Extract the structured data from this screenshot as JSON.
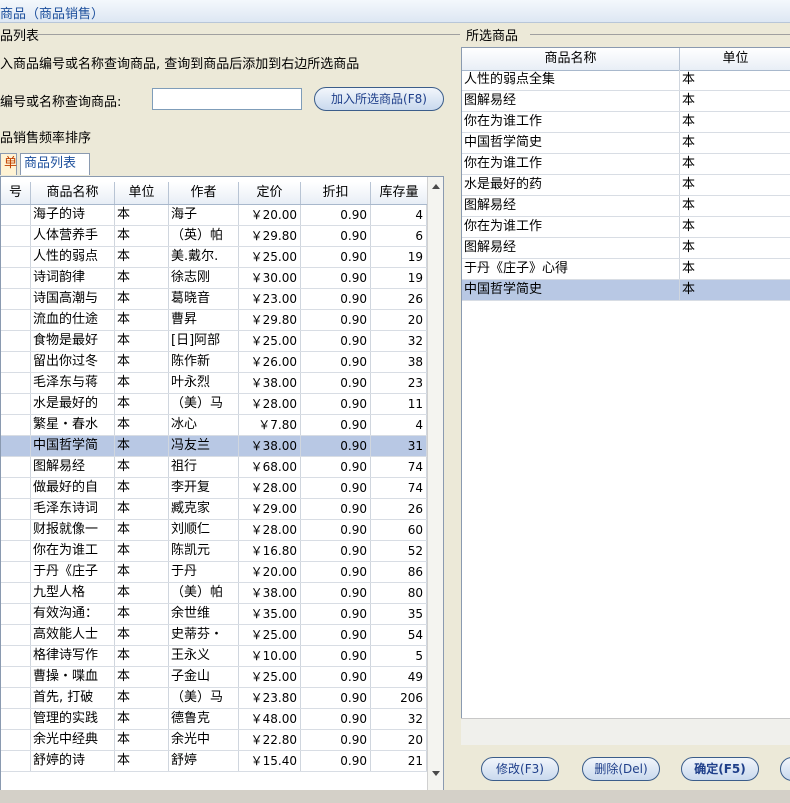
{
  "window": {
    "title": "商品（商品销售）"
  },
  "left_panel": {
    "group_title": "品列表",
    "instruction": "入商品编号或名称查询商品, 查询到商品后添加到右边所选商品",
    "search_label": "编号或名称查询商品:",
    "search_value": "",
    "add_button": "加入所选商品(F8)",
    "sort_title": "品销售频率排序",
    "tabs": [
      "单",
      "商品列表"
    ],
    "columns": [
      "号",
      "商品名称",
      "单位",
      "作者",
      "定价",
      "折扣",
      "库存量"
    ],
    "rows": [
      {
        "id": "",
        "name": "海子的诗",
        "unit": "本",
        "author": "海子",
        "price": "￥20.00",
        "discount": "0.90",
        "stock": "4"
      },
      {
        "id": "",
        "name": "人体营养手",
        "unit": "本",
        "author": "（英）帕",
        "price": "￥29.80",
        "discount": "0.90",
        "stock": "6"
      },
      {
        "id": "",
        "name": "人性的弱点",
        "unit": "本",
        "author": "美.戴尔.",
        "price": "￥25.00",
        "discount": "0.90",
        "stock": "19"
      },
      {
        "id": "",
        "name": "诗词韵律",
        "unit": "本",
        "author": "徐志刚",
        "price": "￥30.00",
        "discount": "0.90",
        "stock": "19"
      },
      {
        "id": "",
        "name": "诗国高潮与",
        "unit": "本",
        "author": "葛晓音",
        "price": "￥23.00",
        "discount": "0.90",
        "stock": "26"
      },
      {
        "id": "",
        "name": "流血的仕途",
        "unit": "本",
        "author": "曹昇",
        "price": "￥29.80",
        "discount": "0.90",
        "stock": "20"
      },
      {
        "id": "",
        "name": "食物是最好",
        "unit": "本",
        "author": "[日]阿部",
        "price": "￥25.00",
        "discount": "0.90",
        "stock": "32"
      },
      {
        "id": "",
        "name": "留出你过冬",
        "unit": "本",
        "author": "陈作新",
        "price": "￥26.00",
        "discount": "0.90",
        "stock": "38"
      },
      {
        "id": "",
        "name": "毛泽东与蒋",
        "unit": "本",
        "author": "叶永烈",
        "price": "￥38.00",
        "discount": "0.90",
        "stock": "23"
      },
      {
        "id": "",
        "name": "水是最好的",
        "unit": "本",
        "author": "（美）马",
        "price": "￥28.00",
        "discount": "0.90",
        "stock": "11"
      },
      {
        "id": "",
        "name": "繁星・春水",
        "unit": "本",
        "author": "冰心",
        "price": "￥7.80",
        "discount": "0.90",
        "stock": "4"
      },
      {
        "id": "",
        "name": "中国哲学简",
        "unit": "本",
        "author": "冯友兰",
        "price": "￥38.00",
        "discount": "0.90",
        "stock": "31",
        "selected": true
      },
      {
        "id": "",
        "name": "图解易经",
        "unit": "本",
        "author": "祖行",
        "price": "￥68.00",
        "discount": "0.90",
        "stock": "74"
      },
      {
        "id": "",
        "name": "做最好的自",
        "unit": "本",
        "author": "李开复",
        "price": "￥28.00",
        "discount": "0.90",
        "stock": "74"
      },
      {
        "id": "",
        "name": "毛泽东诗词",
        "unit": "本",
        "author": "臧克家",
        "price": "￥29.00",
        "discount": "0.90",
        "stock": "26"
      },
      {
        "id": "",
        "name": "财报就像一",
        "unit": "本",
        "author": "刘顺仁",
        "price": "￥28.00",
        "discount": "0.90",
        "stock": "60"
      },
      {
        "id": "",
        "name": "你在为谁工",
        "unit": "本",
        "author": "陈凯元",
        "price": "￥16.80",
        "discount": "0.90",
        "stock": "52"
      },
      {
        "id": "",
        "name": "于丹《庄子",
        "unit": "本",
        "author": "于丹",
        "price": "￥20.00",
        "discount": "0.90",
        "stock": "86"
      },
      {
        "id": "",
        "name": "九型人格",
        "unit": "本",
        "author": "（美）帕",
        "price": "￥38.00",
        "discount": "0.90",
        "stock": "80"
      },
      {
        "id": "",
        "name": "有效沟通：",
        "unit": "本",
        "author": "余世维",
        "price": "￥35.00",
        "discount": "0.90",
        "stock": "35"
      },
      {
        "id": "",
        "name": "高效能人士",
        "unit": "本",
        "author": "史蒂芬・",
        "price": "￥25.00",
        "discount": "0.90",
        "stock": "54"
      },
      {
        "id": "",
        "name": "格律诗写作",
        "unit": "本",
        "author": "王永义",
        "price": "￥10.00",
        "discount": "0.90",
        "stock": "5"
      },
      {
        "id": "",
        "name": "曹操・喋血",
        "unit": "本",
        "author": "子金山",
        "price": "￥25.00",
        "discount": "0.90",
        "stock": "49"
      },
      {
        "id": "",
        "name": "首先, 打破",
        "unit": "本",
        "author": "（美）马",
        "price": "￥23.80",
        "discount": "0.90",
        "stock": "206"
      },
      {
        "id": "",
        "name": "管理的实践",
        "unit": "本",
        "author": "德鲁克",
        "price": "￥48.00",
        "discount": "0.90",
        "stock": "32"
      },
      {
        "id": "",
        "name": "余光中经典",
        "unit": "本",
        "author": "余光中",
        "price": "￥22.80",
        "discount": "0.90",
        "stock": "20"
      },
      {
        "id": "",
        "name": "舒婷的诗",
        "unit": "本",
        "author": "舒婷",
        "price": "￥15.40",
        "discount": "0.90",
        "stock": "21"
      }
    ]
  },
  "right_panel": {
    "group_title": "所选商品",
    "columns": [
      "商品名称",
      "单位"
    ],
    "rows": [
      {
        "name": "人性的弱点全集",
        "unit": "本"
      },
      {
        "name": "图解易经",
        "unit": "本"
      },
      {
        "name": "你在为谁工作",
        "unit": "本"
      },
      {
        "name": "中国哲学简史",
        "unit": "本"
      },
      {
        "name": "你在为谁工作",
        "unit": "本"
      },
      {
        "name": "水是最好的药",
        "unit": "本"
      },
      {
        "name": "图解易经",
        "unit": "本"
      },
      {
        "name": "你在为谁工作",
        "unit": "本"
      },
      {
        "name": "图解易经",
        "unit": "本"
      },
      {
        "name": "于丹《庄子》心得",
        "unit": "本"
      },
      {
        "name": "中国哲学简史",
        "unit": "本",
        "selected": true
      }
    ],
    "buttons": {
      "edit": "修改(F3)",
      "delete": "删除(Del)",
      "confirm": "确定(F5)"
    }
  }
}
